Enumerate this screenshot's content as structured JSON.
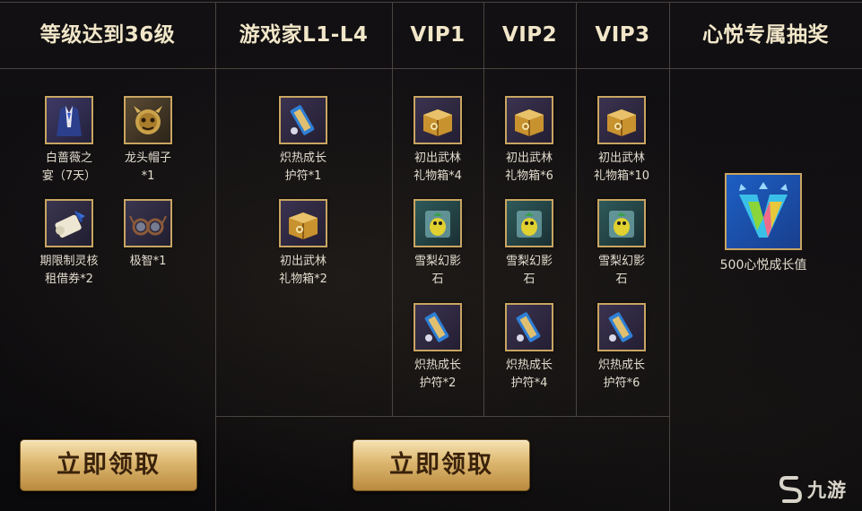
{
  "headers": {
    "level": "等级达到36级",
    "player": "游戏家L1-L4",
    "vip1": "VIP1",
    "vip2": "VIP2",
    "vip3": "VIP3",
    "lottery": "心悦专属抽奖"
  },
  "level_rewards": [
    {
      "line1": "白蔷薇之",
      "line2": "宴（7天）",
      "icon": "suit-icon"
    },
    {
      "line1": "龙头帽子",
      "line2": "*1",
      "icon": "dragon-hat-icon"
    },
    {
      "line1": "期限制灵核",
      "line2": "租借券*2",
      "icon": "scroll-icon"
    },
    {
      "line1": "极智*1",
      "line2": "",
      "icon": "glasses-icon"
    }
  ],
  "player_rewards": [
    {
      "line1": "炽热成长",
      "line2": "护符*1",
      "icon": "talisman-icon"
    },
    {
      "line1": "初出武林",
      "line2": "礼物箱*2",
      "icon": "gift-box-icon"
    }
  ],
  "vip1_rewards": [
    {
      "line1": "初出武林",
      "line2": "礼物箱*4",
      "icon": "gift-box-icon"
    },
    {
      "line1": "雪梨幻影",
      "line2": "石",
      "icon": "phantom-stone-icon"
    },
    {
      "line1": "炽热成长",
      "line2": "护符*2",
      "icon": "talisman-icon"
    }
  ],
  "vip2_rewards": [
    {
      "line1": "初出武林",
      "line2": "礼物箱*6",
      "icon": "gift-box-icon"
    },
    {
      "line1": "雪梨幻影",
      "line2": "石",
      "icon": "phantom-stone-icon"
    },
    {
      "line1": "炽热成长",
      "line2": "护符*4",
      "icon": "talisman-icon"
    }
  ],
  "vip3_rewards": [
    {
      "line1": "初出武林",
      "line2": "礼物箱*10",
      "icon": "gift-box-icon"
    },
    {
      "line1": "雪梨幻影",
      "line2": "石",
      "icon": "phantom-stone-icon"
    },
    {
      "line1": "炽热成长",
      "line2": "护符*6",
      "icon": "talisman-icon"
    }
  ],
  "lottery_reward": {
    "label": "500心悦成长值",
    "icon": "xinyue-growth-icon"
  },
  "buttons": {
    "claim_level": "立即领取",
    "claim_vip": "立即领取"
  },
  "watermark": {
    "text": "九游",
    "icon": "jiuyou-logo-icon"
  },
  "colors": {
    "accent_gold": "#c9a561",
    "header_text": "#f1e6c8",
    "grid_line": "#4a4440"
  }
}
